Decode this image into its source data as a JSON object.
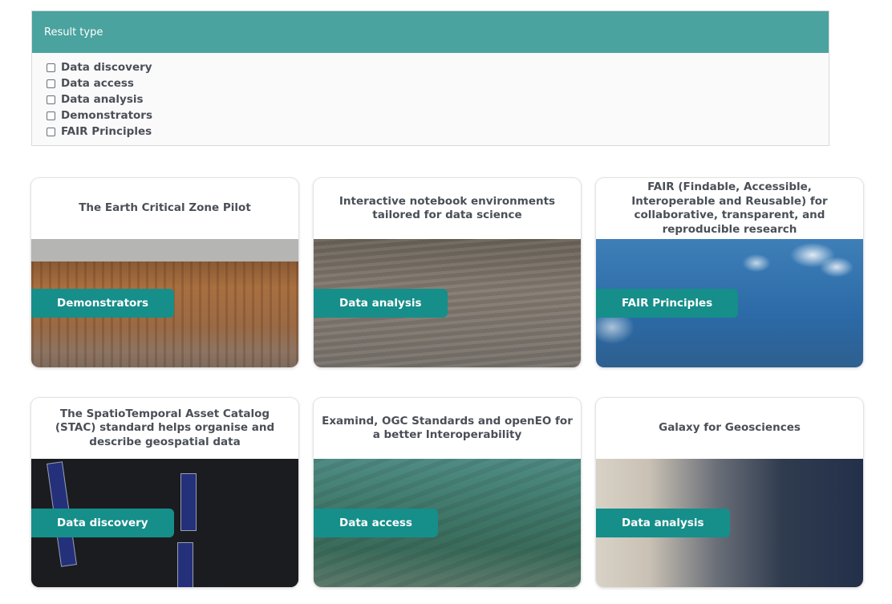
{
  "filter": {
    "header": "Result type",
    "options": [
      {
        "label": "Data discovery",
        "checked": false
      },
      {
        "label": "Data access",
        "checked": false
      },
      {
        "label": "Data analysis",
        "checked": false
      },
      {
        "label": "Demonstrators",
        "checked": false
      },
      {
        "label": "FAIR Principles",
        "checked": false
      }
    ]
  },
  "cards": [
    {
      "title": "The Earth Critical Zone Pilot",
      "tag": "Demonstrators",
      "image": "rock-cliff-image"
    },
    {
      "title": "Interactive notebook environments tailored for data science",
      "tag": "Data analysis",
      "image": "gravel-field-image"
    },
    {
      "title": "FAIR (Findable, Accessible, Interoperable and Reusable) for collaborative, transparent, and reproducible research",
      "tag": "FAIR Principles",
      "image": "sky-clouds-image"
    },
    {
      "title": "The SpatioTemporal Asset Catalog (STAC) standard helps organise and describe geospatial data",
      "tag": "Data discovery",
      "image": "satellite-earth-image"
    },
    {
      "title": "Examind, OGC Standards and openEO for a better Interoperability",
      "tag": "Data access",
      "image": "aerial-landscape-image"
    },
    {
      "title": "Galaxy for Geosciences",
      "tag": "Data analysis",
      "image": "lab-researchers-image"
    }
  ],
  "colors": {
    "filter_header_bg": "#4aa39f",
    "tag_bg": "#168e8a",
    "text": "#4a4f57"
  }
}
